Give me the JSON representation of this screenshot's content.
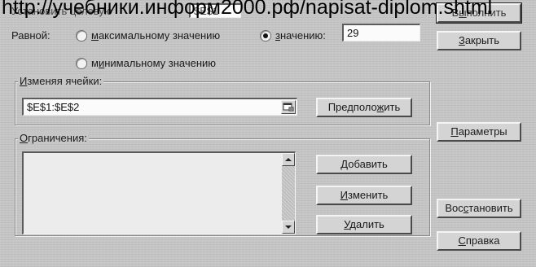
{
  "overlay_url": "http://учебники.информ2000.рф/napisat-diplom.shtml",
  "dialog": {
    "target_cell_label": "Установить целевую",
    "target_cell_value": "$E$1",
    "equal_label": "Равной:",
    "radio_max": {
      "prefix": "",
      "accel": "м",
      "rest": "аксимальному значению",
      "selected": false
    },
    "radio_value": {
      "prefix": "",
      "accel": "з",
      "rest": "начению:",
      "selected": true
    },
    "value_field": "29",
    "radio_min": {
      "prefix": "м",
      "accel": "и",
      "rest": "нимальному значению",
      "selected": false
    },
    "changing_cells_label": {
      "prefix": "",
      "accel": "И",
      "rest": "зменяя ячейки:"
    },
    "changing_cells_value": "$E$1:$E$2",
    "constraints_label": {
      "prefix": "",
      "accel": "О",
      "rest": "граничения:"
    },
    "buttons": {
      "execute": {
        "prefix": "В",
        "accel": "ы",
        "rest": "полнить"
      },
      "close": {
        "prefix": "",
        "accel": "З",
        "rest": "акрыть"
      },
      "guess": {
        "prefix": "Предполо",
        "accel": "ж",
        "rest": "ить"
      },
      "options": {
        "prefix": "",
        "accel": "П",
        "rest": "араметры"
      },
      "add": {
        "prefix": "",
        "accel": "Д",
        "rest": "обавить"
      },
      "change": {
        "prefix": "",
        "accel": "И",
        "rest": "зменить"
      },
      "delete": {
        "prefix": "",
        "accel": "У",
        "rest": "далить"
      },
      "restore": {
        "prefix": "Вос",
        "accel": "с",
        "rest": "тановить"
      },
      "help": {
        "prefix": "",
        "accel": "С",
        "rest": "правка"
      }
    }
  }
}
